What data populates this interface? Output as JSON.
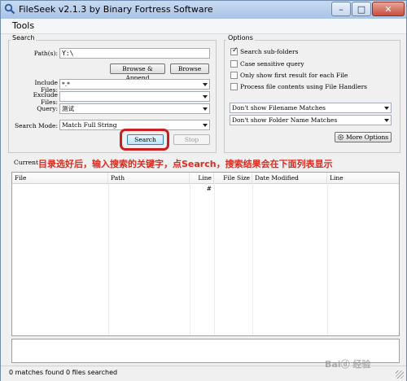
{
  "window": {
    "title": "FileSeek v2.1.3 by Binary Fortress Software",
    "controls": {
      "minimize": "–",
      "maximize": "□",
      "close": "✕"
    }
  },
  "menu": {
    "tools": "Tools"
  },
  "search": {
    "group_label": "Search",
    "path_label": "Path(s):",
    "path_value": "Y:\\",
    "browse_append": "Browse & Append",
    "browse": "Browse",
    "include_label": "Include Files:",
    "include_value": "*.*",
    "exclude_label": "Exclude Files:",
    "exclude_value": "",
    "query_label": "Query:",
    "query_value": "测试",
    "mode_label": "Search Mode:",
    "mode_value": "Match Full String",
    "search_button": "Search",
    "stop_button": "Stop"
  },
  "options": {
    "group_label": "Options",
    "checkboxes": [
      {
        "label": "Search sub-folders",
        "checked": true
      },
      {
        "label": "Case sensitive query",
        "checked": false
      },
      {
        "label": "Only show first result for each File",
        "checked": false
      },
      {
        "label": "Process file contents using File Handlers",
        "checked": false
      }
    ],
    "filename_filter": "Don't show Filename Matches",
    "folder_filter": "Don't show Folder Name Matches",
    "more_options": "More Options"
  },
  "annotation": "目录选好后，输入搜索的关键字，点Search，搜索结果会在下面列表显示",
  "current_label": "Current",
  "results": {
    "columns": [
      "File",
      "Path",
      "Line #",
      "File Size",
      "Date Modified",
      "Line"
    ]
  },
  "status": {
    "matches": "0 matches found",
    "files": "0 files searched"
  },
  "watermark": "Baiⓓ 经验",
  "colors": {
    "annotation": "#e02a1e",
    "highlight": "#cc2020"
  }
}
